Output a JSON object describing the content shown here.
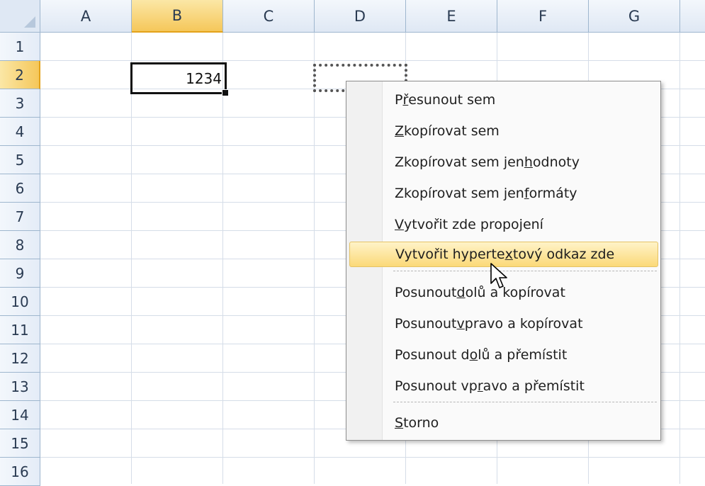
{
  "columns": [
    "A",
    "B",
    "C",
    "D",
    "E",
    "F",
    "G"
  ],
  "active_column": "B",
  "rows": [
    "1",
    "2",
    "3",
    "4",
    "5",
    "6",
    "7",
    "8",
    "9",
    "10",
    "11",
    "12",
    "13",
    "14",
    "15",
    "16"
  ],
  "active_row": "2",
  "cells": {
    "B2": "1234"
  },
  "context_menu": {
    "items": [
      {
        "pre": "P",
        "key": "ř",
        "post": "esunout sem"
      },
      {
        "pre": "",
        "key": "Z",
        "post": "kopírovat sem"
      },
      {
        "pre": "Zkopírovat sem jen ",
        "key": "h",
        "post": "odnoty"
      },
      {
        "pre": "Zkopírovat sem jen ",
        "key": "f",
        "post": "ormáty"
      },
      {
        "pre": "",
        "key": "V",
        "post": "ytvořit zde propojení"
      },
      {
        "pre": "Vytvořit hyperte",
        "key": "x",
        "post": "tový odkaz zde"
      },
      {
        "pre": "Posunout ",
        "key": "d",
        "post": "olů a kopírovat"
      },
      {
        "pre": "Posunout ",
        "key": "v",
        "post": "pravo a kopírovat"
      },
      {
        "pre": "Posunout d",
        "key": "o",
        "post": "lů a přemístit"
      },
      {
        "pre": "Posunout vp",
        "key": "r",
        "post": "avo a přemístit"
      },
      {
        "pre": "",
        "key": "S",
        "post": "torno"
      }
    ],
    "hovered_index": 5
  },
  "colors": {
    "active_header": "#f5c75a",
    "header_bg": "#dfe8f4",
    "menu_hover": "#fbd978"
  }
}
